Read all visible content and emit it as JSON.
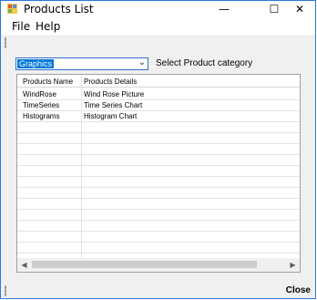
{
  "window": {
    "title": "Products List"
  },
  "window_controls": {
    "minimize": "—",
    "maximize": "☐",
    "close": "✕"
  },
  "menu": [
    "File",
    "Help"
  ],
  "category": {
    "selected": "Graphics",
    "label": "Select Product category"
  },
  "table": {
    "columns": [
      "Products Name",
      "Products Details"
    ],
    "rows": [
      [
        "WindRose",
        "Wind Rose Picture"
      ],
      [
        "TimeSeries",
        "Time Series Chart"
      ],
      [
        "Histograms",
        "Histogram Chart"
      ]
    ]
  },
  "scroll": {
    "left_arrow": "◀",
    "right_arrow": "▶"
  },
  "status": {
    "close_label": "Close"
  },
  "colors": {
    "selection": "#0078d7",
    "border": "#2b79d8"
  }
}
